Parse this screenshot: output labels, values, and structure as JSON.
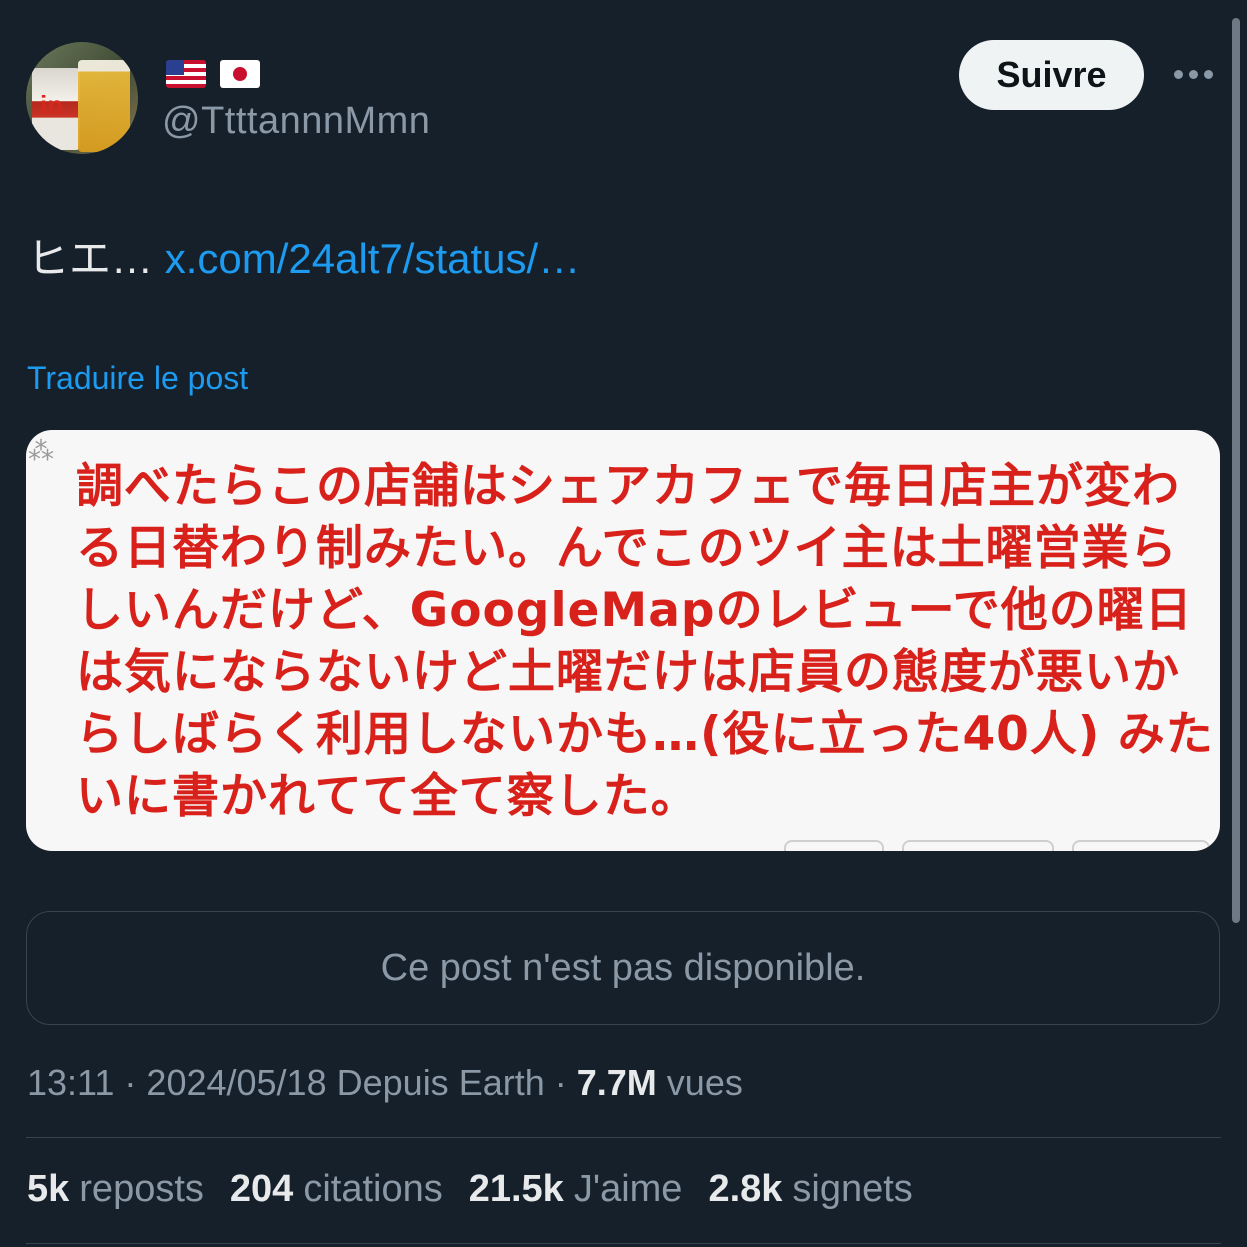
{
  "user": {
    "flags": [
      "us-flag-icon",
      "jp-flag-icon"
    ],
    "handle": "@TtttannnMmn",
    "follow_label": "Suivre"
  },
  "tweet": {
    "text": "ヒエ…",
    "link": "x.com/24alt7/status/…",
    "translate_label": "Traduire le post"
  },
  "media": {
    "text": "調べたらこの店舗はシェアカフェで毎日店主が変わ\nる日替わり制みたい。んでこのツイ主は土曜営業ら\nしいんだけど、GoogleMapのレビューで他の曜日\nは気にならないけど土曜だけは店員の態度が悪いか\nらしばらく利用しないかも…(役に立った40人) みた\nいに書かれてて全て察した。",
    "text_color": "#d9211b"
  },
  "quoted": {
    "unavailable_text": "Ce post n'est pas disponible."
  },
  "meta": {
    "time": "13:11",
    "date": "2024/05/18",
    "source": "Depuis Earth",
    "views_count": "7.7M",
    "views_label": "vues"
  },
  "stats": {
    "reposts_count": "5k",
    "reposts_label": "reposts",
    "quotes_count": "204",
    "quotes_label": "citations",
    "likes_count": "21.5k",
    "likes_label": "J'aime",
    "bookmarks_count": "2.8k",
    "bookmarks_label": "signets"
  },
  "colors": {
    "background": "#15202b",
    "link": "#1d9bf0",
    "muted": "#8b98a5",
    "text": "#e7e9ea"
  }
}
